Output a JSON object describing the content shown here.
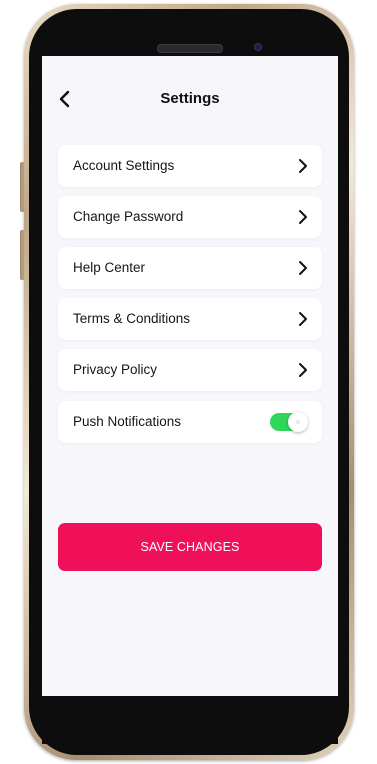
{
  "header": {
    "title": "Settings",
    "back_icon": "chevron-left-icon"
  },
  "settings": {
    "items": [
      {
        "label": "Account Settings",
        "icon": "chevron-right-icon"
      },
      {
        "label": "Change Password",
        "icon": "chevron-right-icon"
      },
      {
        "label": "Help Center",
        "icon": "chevron-right-icon"
      },
      {
        "label": "Terms & Conditions",
        "icon": "chevron-right-icon"
      },
      {
        "label": "Privacy Policy",
        "icon": "chevron-right-icon"
      }
    ],
    "push": {
      "label": "Push Notifications",
      "enabled": true,
      "toggle_color": "#2fd65a"
    }
  },
  "save": {
    "label": "SAVE CHANGES",
    "color": "#f0105a"
  }
}
